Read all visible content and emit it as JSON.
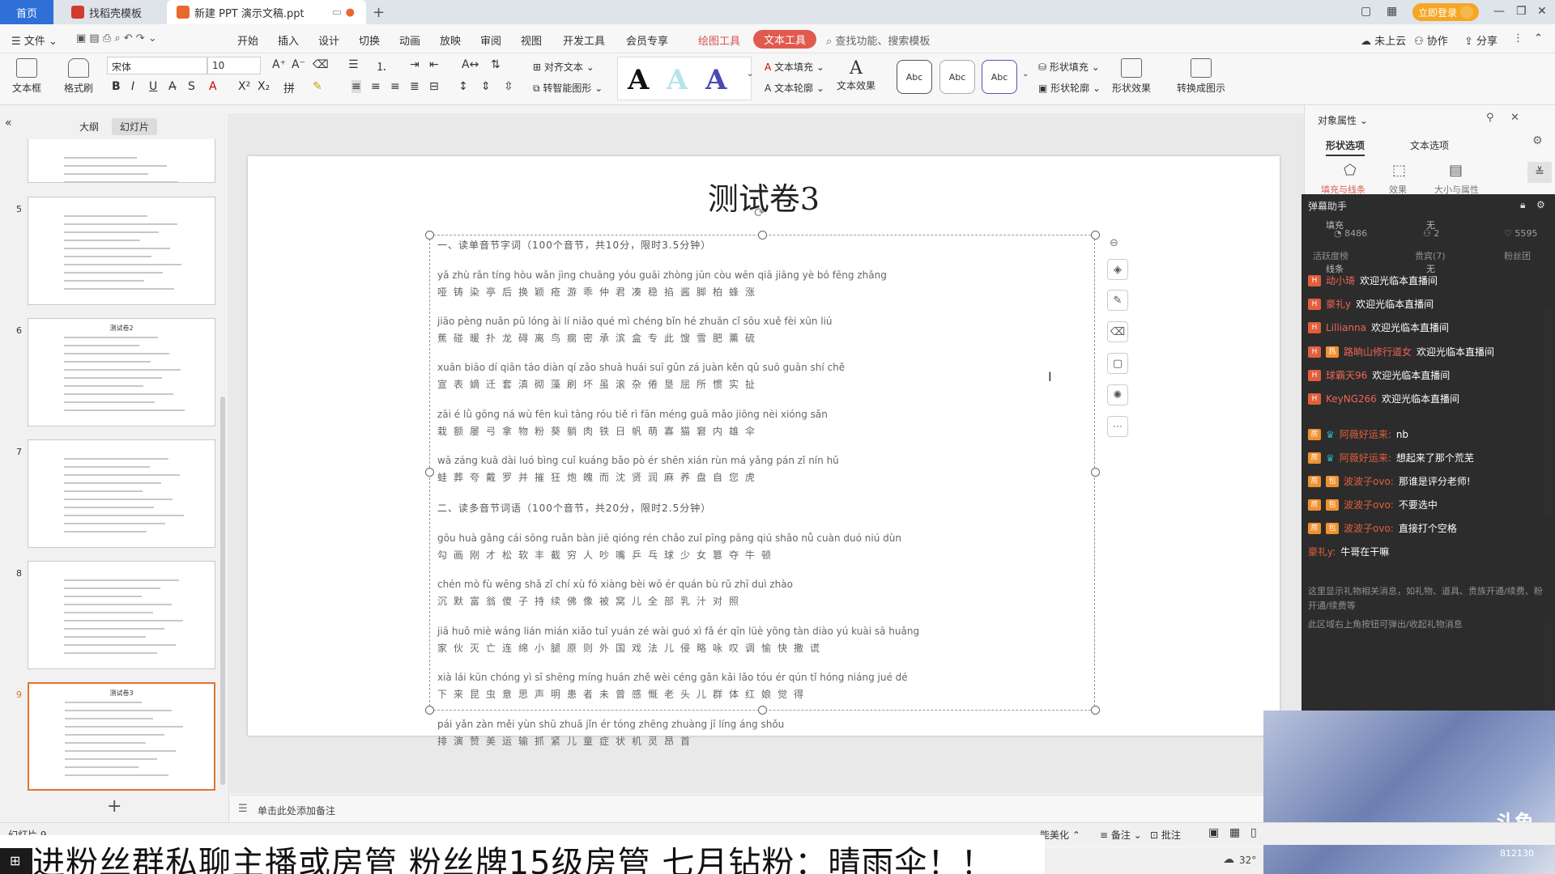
{
  "titlebar": {
    "home_tab": "首页",
    "tab_template": "找稻壳模板",
    "tab_doc": "新建 PPT 演示文稿.ppt",
    "login_button": "立即登录"
  },
  "menubar": {
    "file": "文件",
    "items": [
      "开始",
      "插入",
      "设计",
      "切换",
      "动画",
      "放映",
      "审阅",
      "视图",
      "开发工具",
      "会员专享"
    ],
    "drawing_tools": "绘图工具",
    "text_tools": "文本工具",
    "search_placeholder": "查找功能、搜索模板",
    "not_on_cloud": "未上云",
    "collaborate": "协作",
    "share": "分享"
  },
  "ribbon": {
    "textbox": "文本框",
    "format_painter": "格式刷",
    "font_name": "宋体",
    "font_size": "10",
    "align_text": "对齐文本",
    "smart_shape": "转智能图形",
    "text_fill": "文本填充",
    "text_outline": "文本轮廓",
    "text_effect": "文本效果",
    "shape_fill": "形状填充",
    "shape_outline": "形状轮廓",
    "shape_effect": "形状效果",
    "convert_diagram": "转换成图示",
    "abc": "Abc"
  },
  "leftpanel": {
    "tab_outline": "大纲",
    "tab_slides": "幻灯片",
    "thumbnails": [
      {
        "num": "5",
        "title": ""
      },
      {
        "num": "6",
        "title": "测试卷2"
      },
      {
        "num": "7",
        "title": ""
      },
      {
        "num": "8",
        "title": ""
      },
      {
        "num": "9",
        "title": "测试卷3"
      }
    ],
    "add": "+"
  },
  "slide": {
    "title": "测试卷3",
    "section1": "一、读单音节字词（100个音节，共10分，限时3.5分钟）",
    "section2": "二、读多音节词语（100个音节，共20分，限时2.5分钟）",
    "lines": [
      {
        "py": "yǎ zhù rǎn tíng hòu wǎn jìng chuāng yóu guāi  zhòng jūn còu wēn qiā jiāng yè bó fēng zhǎng",
        "hz": "哑铸染亭后换颖疮游乖仲君凑稳掐酱脚柏蜂涨"
      },
      {
        "py": "jiāo pèng nuǎn pū lóng ài lí niǎo qué mì chéng bǐn hé zhuān cǐ sōu xuě fèi xūn liú",
        "hz": "蕉碰暖扑龙碍离鸟瘸密承滨盒专此馊雪肥薰硫"
      },
      {
        "py": "xuān biāo dí qiān tāo diàn qí zǎo shuā huái suī gǔn zá juàn kěn qǔ suō guān shí chě",
        "hz": "宣表嫡迁套滇砌藻刷坏虽滚杂倦垦屈所惯实扯"
      },
      {
        "py": "zāi é  lǜ gōng ná wù fēn kuì tāng róu  tiě  rì fān méng guā mǎo jiōng nèi xióng sǎn",
        "hz": "栽额屡弓拿物粉葵躺肉铁日帆萌寡猫窘内雄伞"
      },
      {
        "py": "wā záng kuā dài luó bìng cuǐ kuáng bǎo pò  ér  shēn xián rùn má yǎng pán zǐ nín hǔ",
        "hz": "蛙葬夸戴罗并摧狂炮魄而沈贤润麻养盘自您虎"
      },
      {
        "py": "gōu huà gǎng cái sōng ruǎn bàn jiē qióng rén chǎo zuǐ pīng pāng qiú shǎo nǚ cuàn duó niú dùn",
        "hz": "勾画刚才松软丰截穷人吵嘴乒乓球少女篡夺牛顿"
      },
      {
        "py": "chén mò fù wēng shǎ zǐ chí xù fó xiàng bèi wō ér quán bù rǔ zhī duì zhào",
        "hz": "沉默富翁傻子持续佛像被窝儿全部乳汁对照"
      },
      {
        "py": "jiā huǒ miè wáng lián mián xiǎo tuǐ yuán zé wài guó xì fǎ ér qīn lüè yōng tàn diào yú kuài sā huǎng",
        "hz": "家伙灭亡连绵小腿原则外国戏法儿侵略咏叹调愉快撒谎"
      },
      {
        "py": "xià lái kūn chóng yì sī shēng míng huán zhě wèi céng gǎn kǎi lǎo tóu ér qún tǐ hóng niáng jué dé",
        "hz": "下来昆虫意思声明患者未曾感慨老头儿群体红娘觉得"
      },
      {
        "py": "pái yǎn zàn měi yùn shū zhuā jǐn ér tóng zhēng zhuàng jī líng  áng shǒu",
        "hz": "排演赞美运输抓紧儿童症状机灵昂首"
      }
    ]
  },
  "notes": {
    "placeholder": "单击此处添加备注"
  },
  "rightpanel": {
    "title": "对象属性",
    "tab_shape": "形状选项",
    "tab_text": "文本选项",
    "sub_fill": "填充与线条",
    "sub_effect": "效果",
    "sub_size": "大小与属性",
    "fill": "填充",
    "fill_value": "无",
    "line": "线条",
    "line_value": "无"
  },
  "danmu": {
    "title": "弹幕助手",
    "stat_hot": "8486",
    "stat_users": "2",
    "stat_fans": "5595",
    "labels": {
      "active": "活跃度榜",
      "vip": "贵宾(7)",
      "fans": "粉丝团"
    },
    "welcome": [
      {
        "name": "动小琦",
        "msg": "欢迎光临本直播间"
      },
      {
        "name": "豪礼y",
        "msg": "欢迎光临本直播间"
      },
      {
        "name": "Lillianna",
        "msg": "欢迎光临本直播间"
      },
      {
        "name": "路晌山修行道女",
        "msg": "欢迎光临本直播间"
      },
      {
        "name": "球霸天96",
        "msg": "欢迎光临本直播间"
      },
      {
        "name": "KeyNG266",
        "msg": "欢迎光临本直播间"
      }
    ],
    "chat": [
      {
        "name": "阿薇好运来:",
        "msg": "nb"
      },
      {
        "name": "阿薇好运来:",
        "msg": "想起来了那个荒芜"
      },
      {
        "name": "波波子ovo:",
        "msg": "那谁是评分老师!"
      },
      {
        "name": "波波子ovo:",
        "msg": "不要选中"
      },
      {
        "name": "波波子ovo:",
        "msg": "直接打个空格"
      },
      {
        "name": "豪礼y:",
        "msg": "牛哥在干嘛"
      }
    ],
    "sys_msg1": "这里显示礼物相关消息，如礼物、道具、贵族开通/续费、粉开通/续费等",
    "sys_msg2": "此区域右上角按钮可弹出/收起礼物消息"
  },
  "statusbar": {
    "slide_no": "幻灯片 9",
    "beautify": "能美化",
    "notes": "备注",
    "comments": "批注",
    "temperature": "32°"
  },
  "banner": {
    "text": "进粉丝群私聊主播或房管 粉丝牌15级房管 七月钻粉：晴雨伞！！"
  },
  "video": {
    "logo": "斗鱼",
    "room": "812130"
  }
}
